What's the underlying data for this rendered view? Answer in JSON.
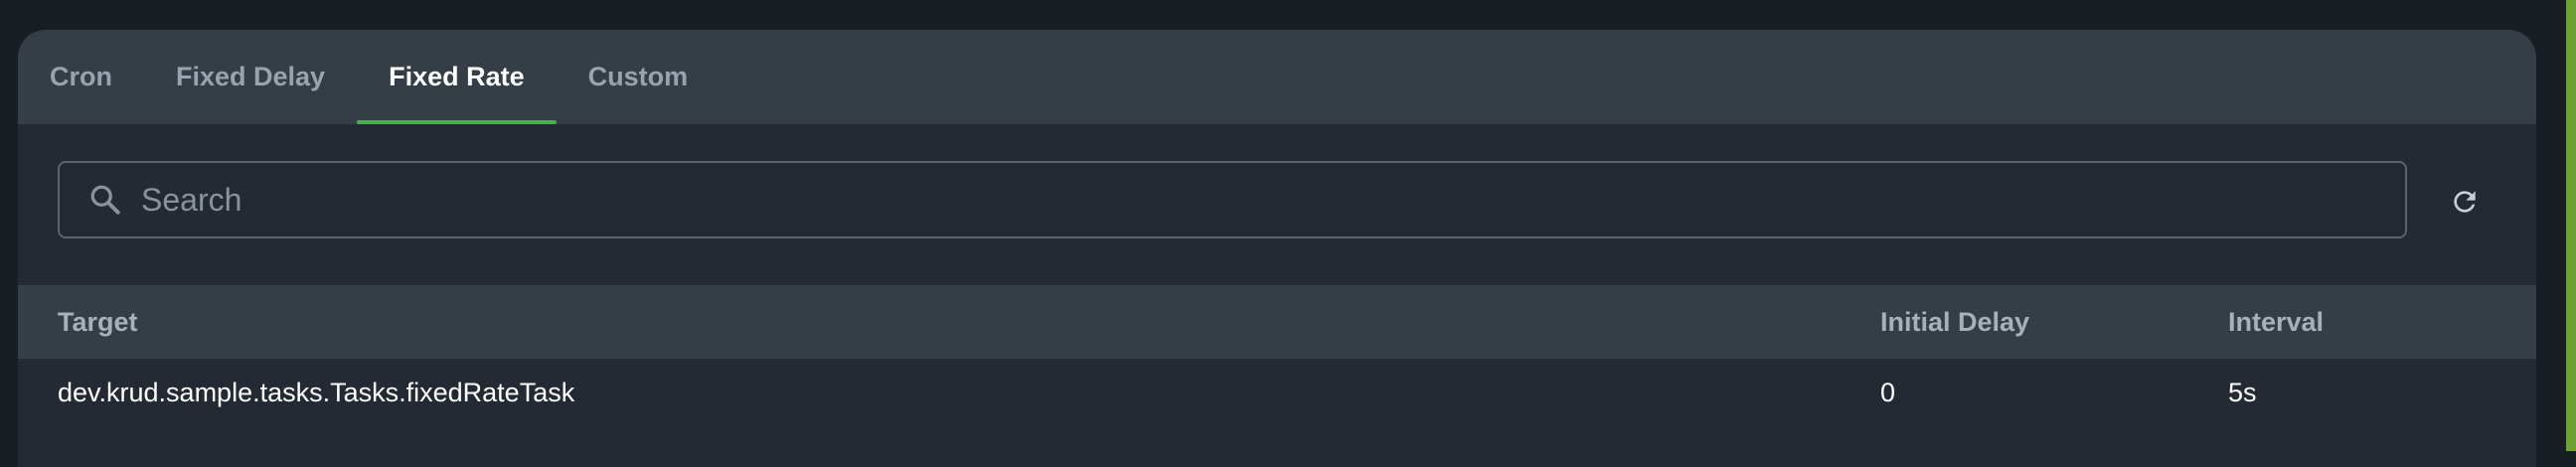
{
  "tabs": [
    {
      "label": "Cron",
      "active": false
    },
    {
      "label": "Fixed Delay",
      "active": false
    },
    {
      "label": "Fixed Rate",
      "active": true
    },
    {
      "label": "Custom",
      "active": false
    }
  ],
  "search": {
    "placeholder": "Search",
    "value": "",
    "icon": "search-icon"
  },
  "toolbar": {
    "refresh_icon": "refresh-icon"
  },
  "table": {
    "columns": [
      "Target",
      "Initial Delay",
      "Interval"
    ],
    "rows": [
      [
        "dev.krud.sample.tasks.Tasks.fixedRateTask",
        "0",
        "5s"
      ]
    ]
  },
  "colors": {
    "accent": "#4caf50",
    "side_accent": "#6fa033",
    "panel": "#232a33",
    "header": "#353d47"
  }
}
